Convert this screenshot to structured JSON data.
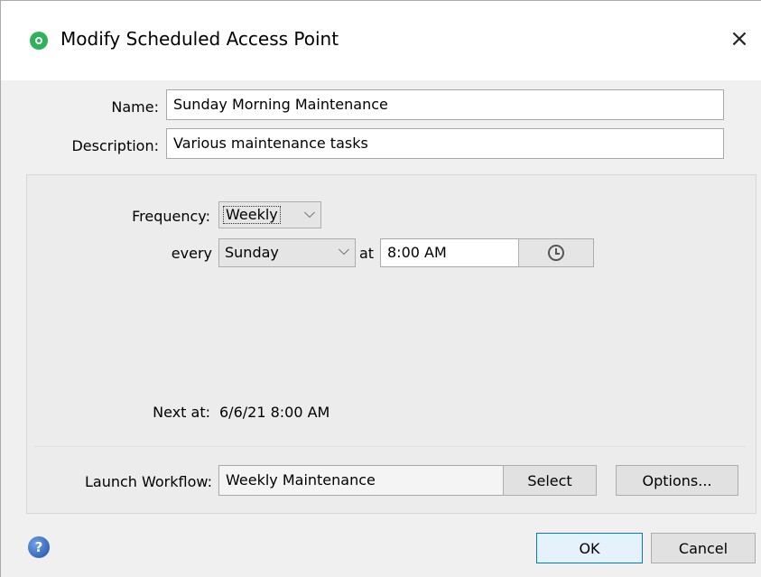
{
  "window": {
    "title": "Modify Scheduled Access Point",
    "close_symbol": "×"
  },
  "form": {
    "name_label": "Name:",
    "name_value": "Sunday Morning Maintenance",
    "description_label": "Description:",
    "description_value": "Various maintenance tasks"
  },
  "schedule": {
    "frequency_label": "Frequency:",
    "frequency_value": "Weekly",
    "every_label": "every",
    "day_value": "Sunday",
    "at_label": "at",
    "time_value": "8:00 AM",
    "next_label": "Next at:",
    "next_value": "6/6/21 8:00 AM"
  },
  "workflow": {
    "label": "Launch Workflow:",
    "value": "Weekly Maintenance",
    "select_label": "Select",
    "options_label": "Options..."
  },
  "footer": {
    "ok_label": "OK",
    "cancel_label": "Cancel"
  },
  "icons": {
    "title": "scheduled-access-point-icon",
    "close": "close-icon",
    "dropdown": "chevron-down-icon",
    "time_picker": "clock-icon",
    "help": "help-icon"
  },
  "colors": {
    "title_icon": "#2eb35a",
    "primary_border": "#0078d7",
    "primary_bg": "#e5f1fb"
  }
}
